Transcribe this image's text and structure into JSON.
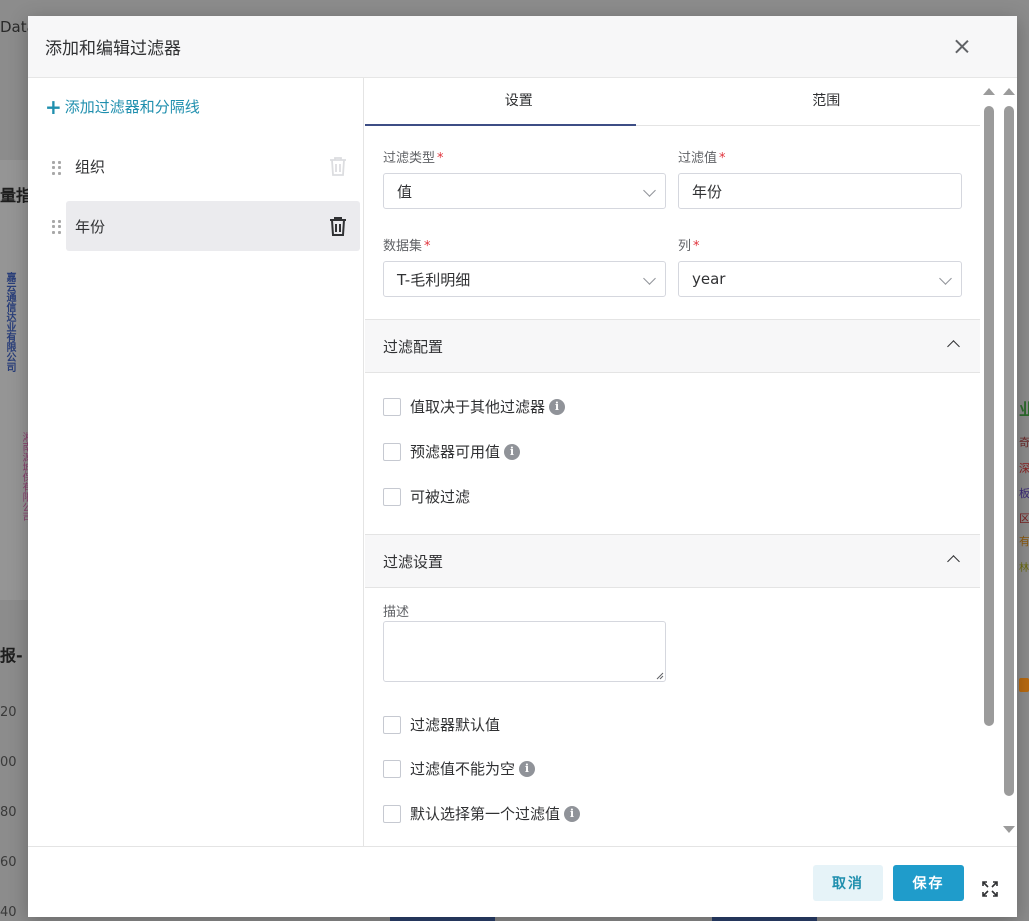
{
  "background": {
    "top_left_text": "Data",
    "left_title_1": "量指",
    "left_title_2": "报-",
    "left_vertical_1": "嘉云通信达业有限公司",
    "left_vertical_2": "湘南源城保有限公司",
    "axis_ticks": [
      "20",
      "00",
      "80",
      "60",
      "40"
    ],
    "right_labels": [
      "业",
      "奇",
      "深",
      "板",
      "区",
      "有",
      "林"
    ]
  },
  "modal": {
    "title": "添加和编辑过滤器"
  },
  "left_panel": {
    "add_label": "添加过滤器和分隔线",
    "items": [
      {
        "label": "组织"
      },
      {
        "label": "年份"
      }
    ]
  },
  "tabs": [
    {
      "label": "设置"
    },
    {
      "label": "范围"
    }
  ],
  "form": {
    "filter_type": {
      "label": "过滤类型",
      "value": "值"
    },
    "filter_value": {
      "label": "过滤值",
      "value": "年份"
    },
    "dataset": {
      "label": "数据集",
      "value": "T-毛利明细"
    },
    "column": {
      "label": "列",
      "value": "year"
    },
    "required_mark": "*"
  },
  "filter_config": {
    "title": "过滤配置",
    "options": [
      {
        "label": "值取决于其他过滤器",
        "info": true
      },
      {
        "label": "预滤器可用值",
        "info": true
      },
      {
        "label": "可被过滤",
        "info": false
      }
    ]
  },
  "filter_settings": {
    "title": "过滤设置",
    "description_label": "描述",
    "description_value": "",
    "options": [
      {
        "label": "过滤器默认值",
        "info": false
      },
      {
        "label": "过滤值不能为空",
        "info": true
      },
      {
        "label": "默认选择第一个过滤值",
        "info": true
      }
    ]
  },
  "info_glyph": "i",
  "footer": {
    "cancel_label": "取消",
    "save_label": "保存"
  },
  "colors": {
    "accent": "#1f8fae",
    "primary_button": "#1f9ccb",
    "tab_ink": "#3d4e85",
    "required": "#e0313a"
  }
}
